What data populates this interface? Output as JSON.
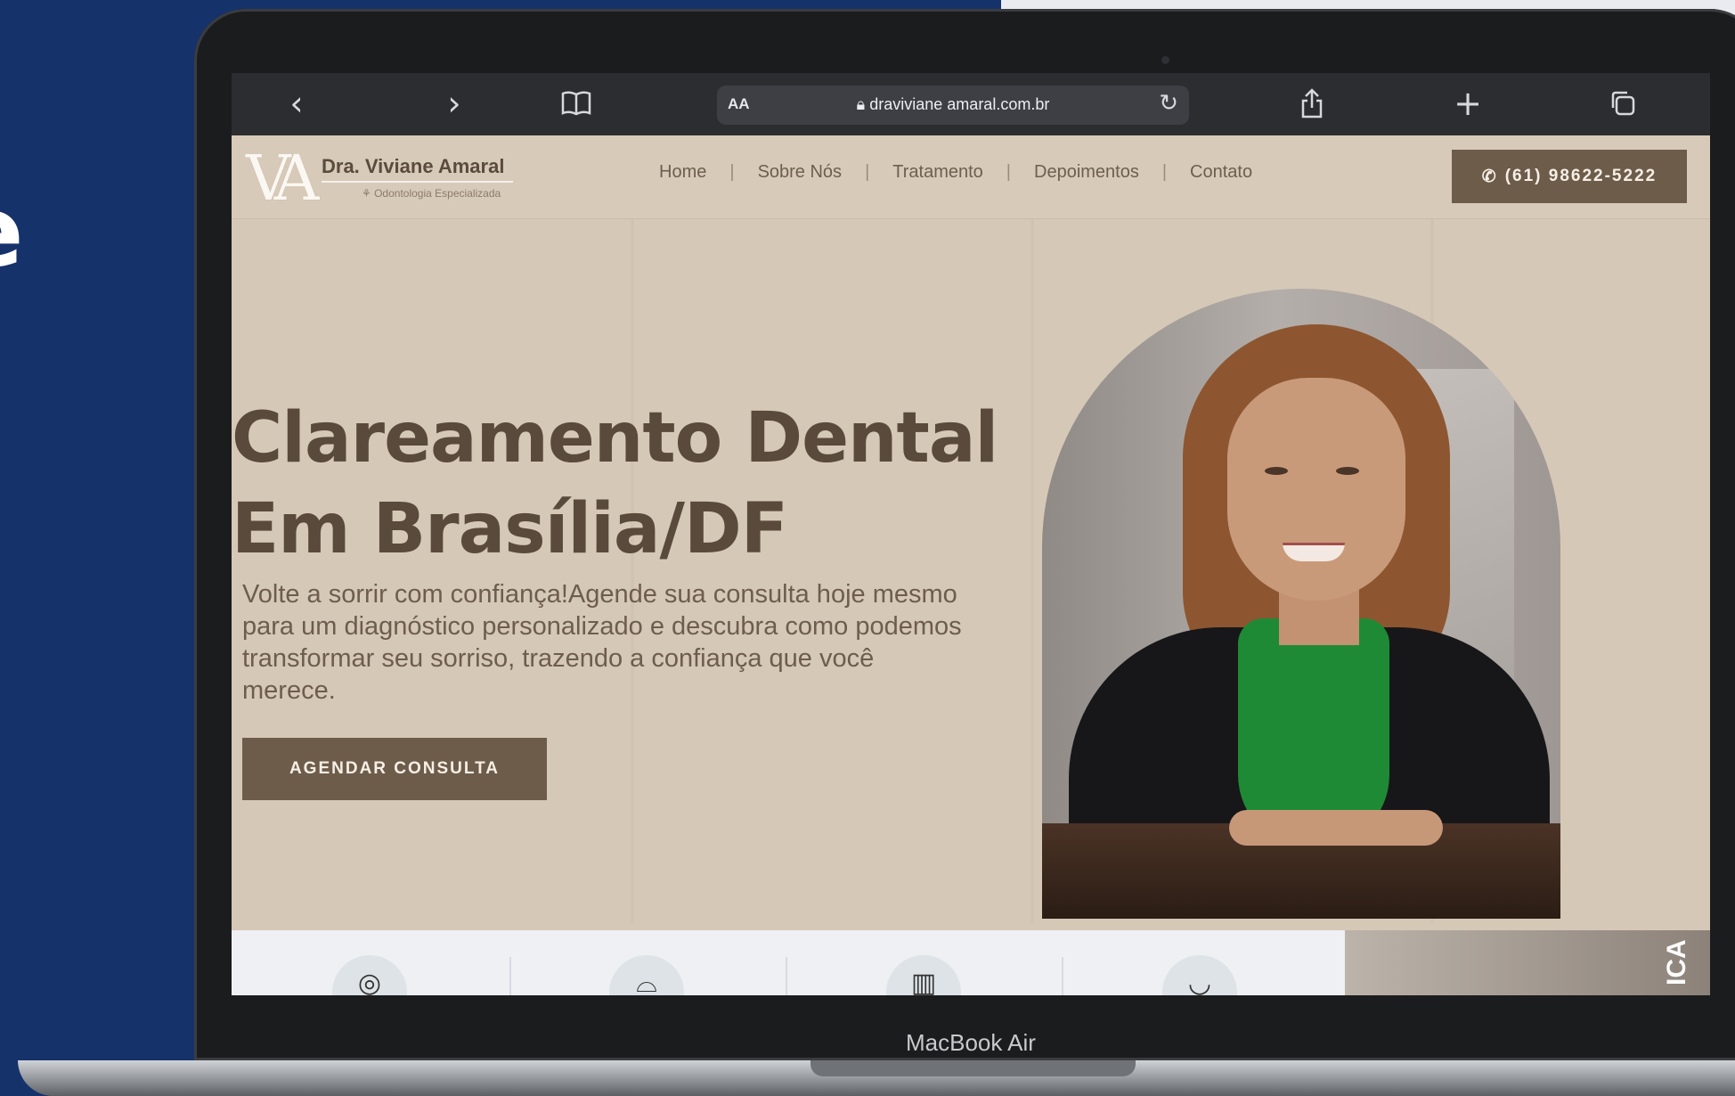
{
  "background": {
    "partial_letter": "e"
  },
  "browser": {
    "address_label": "AA",
    "url": "draviviane amaral.com.br",
    "icons": [
      "back-icon",
      "forward-icon",
      "bookmarks-icon",
      "lock-icon",
      "reload-icon",
      "share-icon",
      "new-tab-icon",
      "tabs-icon"
    ]
  },
  "site": {
    "logo": {
      "mark": "VA",
      "name": "Dra. Viviane Amaral",
      "tagline": "Odontologia Especializada"
    },
    "nav": [
      "Home",
      "Sobre Nós",
      "Tratamento",
      "Depoimentos",
      "Contato"
    ],
    "nav_separator": "|",
    "phone_button": "(61)  98622-5222"
  },
  "hero": {
    "title_line1": "Clareamento Dental",
    "title_line2": "Em Brasília/DF",
    "subtitle": "Volte a sorrir com confiança!Agende sua consulta hoje mesmo para um diagnóstico personalizado e descubra como podemos transformar seu sorriso, trazendo a confiança que você merece.",
    "cta": "AGENDAR  CONSULTA"
  },
  "strip": {
    "side_text": "ICA"
  },
  "device": {
    "label": "MacBook Air"
  },
  "colors": {
    "brand_brown": "#6e5c4b",
    "beige": "#d6c8b7",
    "navy_bg": "#16326b",
    "scarf_green": "#1f8a35"
  }
}
